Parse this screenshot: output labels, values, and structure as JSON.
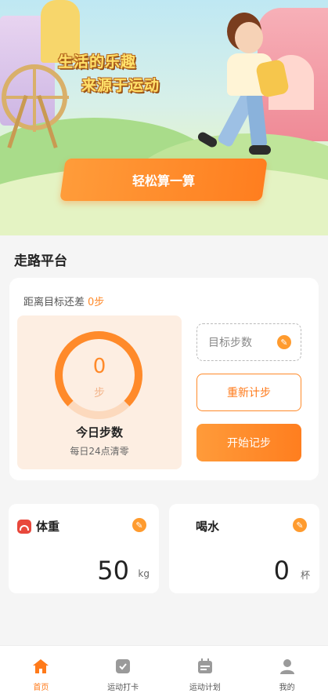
{
  "hero": {
    "slogan_line1": "生活的乐趣",
    "slogan_line2": "来源于运动",
    "calc_button": "轻松算一算"
  },
  "walk": {
    "section_title": "走路平台",
    "diff_label": "距离目标还差",
    "diff_value": "0步",
    "steps_value": "0",
    "steps_unit": "步",
    "steps_progress_fraction": 0,
    "today_label": "今日步数",
    "today_sub": "每日24点清零",
    "goal_placeholder": "目标步数",
    "reset_button": "重新计步",
    "start_button": "开始记步"
  },
  "weight": {
    "label": "体重",
    "value": "50",
    "unit": "kg"
  },
  "water": {
    "label": "喝水",
    "value": "0",
    "unit": "杯"
  },
  "nav": {
    "items": [
      {
        "label": "首页",
        "icon": "home-icon",
        "active": true
      },
      {
        "label": "运动打卡",
        "icon": "checkin-icon",
        "active": false
      },
      {
        "label": "运动计划",
        "icon": "calendar-icon",
        "active": false
      },
      {
        "label": "我的",
        "icon": "user-icon",
        "active": false
      }
    ]
  },
  "colors": {
    "accent": "#ff8a2a",
    "active_nav": "#ff7a1a",
    "inactive_nav": "#999999"
  }
}
